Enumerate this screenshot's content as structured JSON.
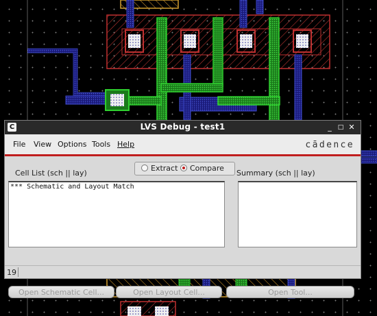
{
  "window": {
    "title": "LVS Debug - test1",
    "app_icon_glyph": "C",
    "controls": {
      "minimize": "_",
      "maximize": "□",
      "close": "✕"
    }
  },
  "menu": {
    "items": [
      "File",
      "View",
      "Options",
      "Tools",
      "Help"
    ],
    "brand": "cādence"
  },
  "panel": {
    "cell_list_label": "Cell List (sch || lay)",
    "summary_label": "Summary (sch || lay)",
    "mode": {
      "options": [
        "Extract",
        "Compare"
      ],
      "selected": "Compare"
    },
    "cell_list_items": [
      "*** Schematic and Layout Match"
    ],
    "summary_items": []
  },
  "buttons": {
    "open_schematic": "Open Schematic Cell...",
    "open_layout": "Open Layout Cell...",
    "open_tool": "Open Tool..."
  },
  "status": {
    "count": "19"
  },
  "colors": {
    "accent_red": "#c01e1e",
    "titlebar": "#2a2a2a",
    "dialog_bg": "#d9d9d9"
  }
}
